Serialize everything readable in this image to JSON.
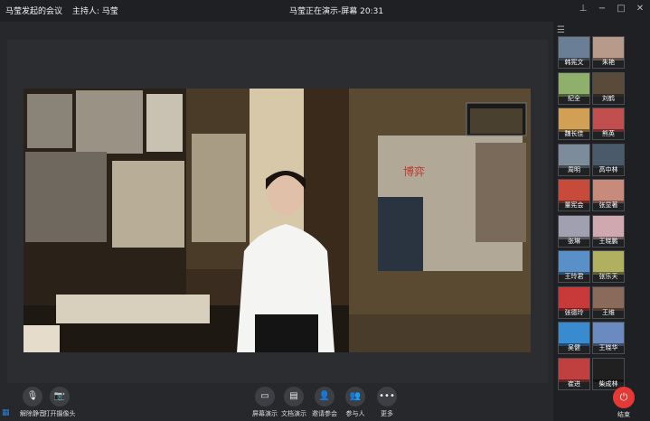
{
  "titlebar": {
    "meeting_name": "马莹发起的会议",
    "host": "主持人: 马莹",
    "status": "马莹正在演示-屏幕 20:31"
  },
  "participants": [
    {
      "name": "韩宪文",
      "color": "#6a7f96"
    },
    {
      "name": "朱艳",
      "color": "#b89a8a"
    },
    {
      "name": "纪全",
      "color": "#8fb06a"
    },
    {
      "name": "刘鹤",
      "color": "#5a4a3a"
    },
    {
      "name": "魏长佳",
      "color": "#d1a054"
    },
    {
      "name": "熊英",
      "color": "#c05050"
    },
    {
      "name": "周明",
      "color": "#7d8c9a"
    },
    {
      "name": "高中林",
      "color": "#4a5a6a"
    },
    {
      "name": "董宪会",
      "color": "#c84a3a"
    },
    {
      "name": "张显著",
      "color": "#c88a7a"
    },
    {
      "name": "张琳",
      "color": "#a0a0b0"
    },
    {
      "name": "王晓鹏",
      "color": "#d0a8b0"
    },
    {
      "name": "王玲君",
      "color": "#5a90c8"
    },
    {
      "name": "张乐天",
      "color": "#b0b060"
    },
    {
      "name": "张德玲",
      "color": "#c83a3a"
    },
    {
      "name": "王维",
      "color": "#8a6a5a"
    },
    {
      "name": "吴健",
      "color": "#3a8ad0"
    },
    {
      "name": "王晓华",
      "color": "#6a8ac0"
    },
    {
      "name": "崔进",
      "color": "#c04040"
    },
    {
      "name": "柴成林",
      "color": "#202020"
    },
    {
      "name": "",
      "color": "#b07080"
    },
    {
      "name": "",
      "color": "#d0c0b0"
    }
  ],
  "toolbar": {
    "mute_label": "解除静音",
    "camera_label": "打开摄像头",
    "share_screen_label": "屏幕演示",
    "share_doc_label": "文档演示",
    "invite_label": "邀请参会",
    "participants_label": "参与人",
    "more_label": "更多",
    "end_label": "结束"
  },
  "video": {
    "exhibit_title": "博弈"
  },
  "colors": {
    "end_button": "#e53935",
    "titlebar_bg": "#1f2023",
    "stage_bg": "#2b2d31"
  }
}
